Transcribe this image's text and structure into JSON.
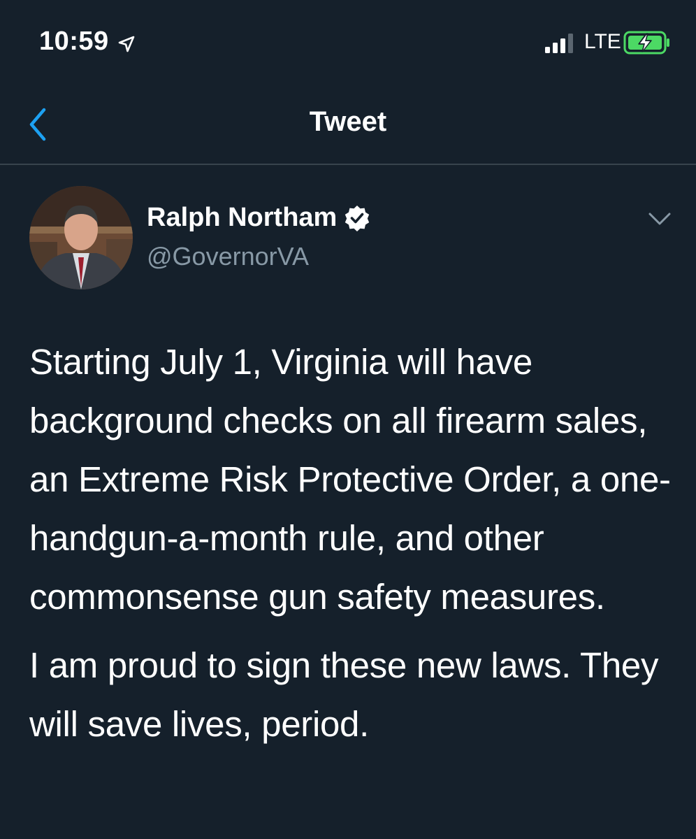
{
  "status_bar": {
    "time": "10:59",
    "network": "LTE",
    "icons": {
      "location": "location-arrow-icon",
      "signal": "cellular-signal-icon",
      "battery": "battery-charging-icon"
    },
    "battery_color": "#4cd964"
  },
  "nav": {
    "title": "Tweet",
    "back_icon": "chevron-left-icon",
    "accent_color": "#1da1f2"
  },
  "tweet": {
    "author": {
      "name": "Ralph Northam",
      "handle": "@GovernorVA",
      "verified_icon": "verified-badge-icon"
    },
    "more_icon": "chevron-down-icon",
    "paragraphs": [
      "Starting July 1, Virginia will have background checks on all firearm sales, an Extreme Risk Protective Order, a one-handgun-a-month rule, and other commonsense gun safety measures.",
      "I am proud to sign these new laws. They will save lives, period."
    ]
  },
  "theme": {
    "background": "#15202b",
    "text_primary": "#ffffff",
    "text_secondary": "#8899a6",
    "divider": "#38444d"
  }
}
